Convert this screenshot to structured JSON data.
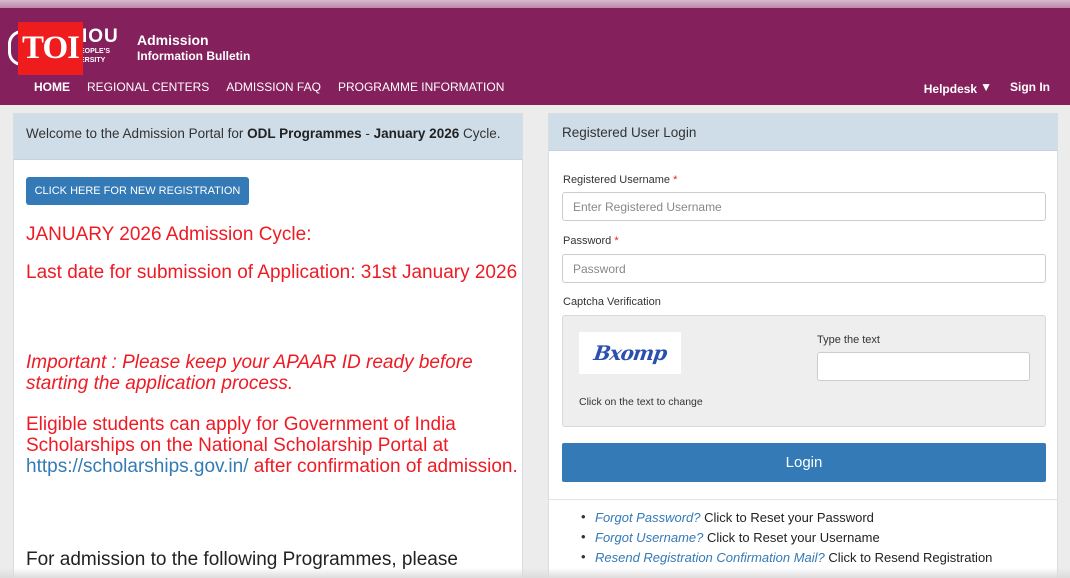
{
  "header": {
    "logo_text": "IGNOU",
    "logo_visible_big": "IOU",
    "logo_line1": "EOPLE'S",
    "logo_line2": "ERSITY",
    "watermark": "TOI",
    "title": "Admission",
    "subtitle": "Information Bulletin"
  },
  "nav": {
    "items": [
      {
        "label": "HOME",
        "active": true
      },
      {
        "label": "REGIONAL CENTERS"
      },
      {
        "label": "ADMISSION FAQ"
      },
      {
        "label": "PROGRAMME INFORMATION"
      }
    ],
    "helpdesk": "Helpdesk",
    "signin": "Sign In"
  },
  "left_panel": {
    "welcome_prefix": "Welcome to the Admission Portal for ",
    "welcome_bold1": "ODL Programmes",
    "welcome_mid": " - ",
    "welcome_bold2": "January 2026",
    "welcome_suffix": " Cycle.",
    "register_button": "CLICK HERE FOR NEW REGISTRATION",
    "cycle_heading": "JANUARY 2026 Admission Cycle:",
    "last_date": "Last date for submission of Application: 31st January 2026",
    "important": "Important : Please keep your APAAR ID ready before starting the application process.",
    "eligible_prefix": "Eligible students can apply for Government of India Scholarships on the National Scholarship Portal at ",
    "eligible_link": "https://scholarships.gov.in/",
    "eligible_suffix": " after confirmation of admission.",
    "admission_text": "For admission to the following Programmes, please"
  },
  "login": {
    "heading": "Registered User Login",
    "username_label": "Registered Username",
    "username_placeholder": "Enter Registered Username",
    "password_label": "Password",
    "password_placeholder": "Password",
    "required_mark": "*",
    "captcha_label": "Captcha Verification",
    "captcha_text": "Bxomp",
    "captcha_type_label": "Type the text",
    "captcha_hint": "Click on the text to change",
    "login_button": "Login",
    "links": [
      {
        "link": "Forgot Password?",
        "text": " Click to Reset your Password"
      },
      {
        "link": "Forgot Username?",
        "text": " Click to Reset your Username"
      },
      {
        "link": "Resend Registration Confirmation Mail?",
        "text": " Click to Resend Registration"
      }
    ]
  },
  "colors": {
    "header_bg": "#84205c",
    "primary_button": "#337ab7",
    "alert_red": "#ee1b24",
    "panel_head": "#cfdde8"
  }
}
